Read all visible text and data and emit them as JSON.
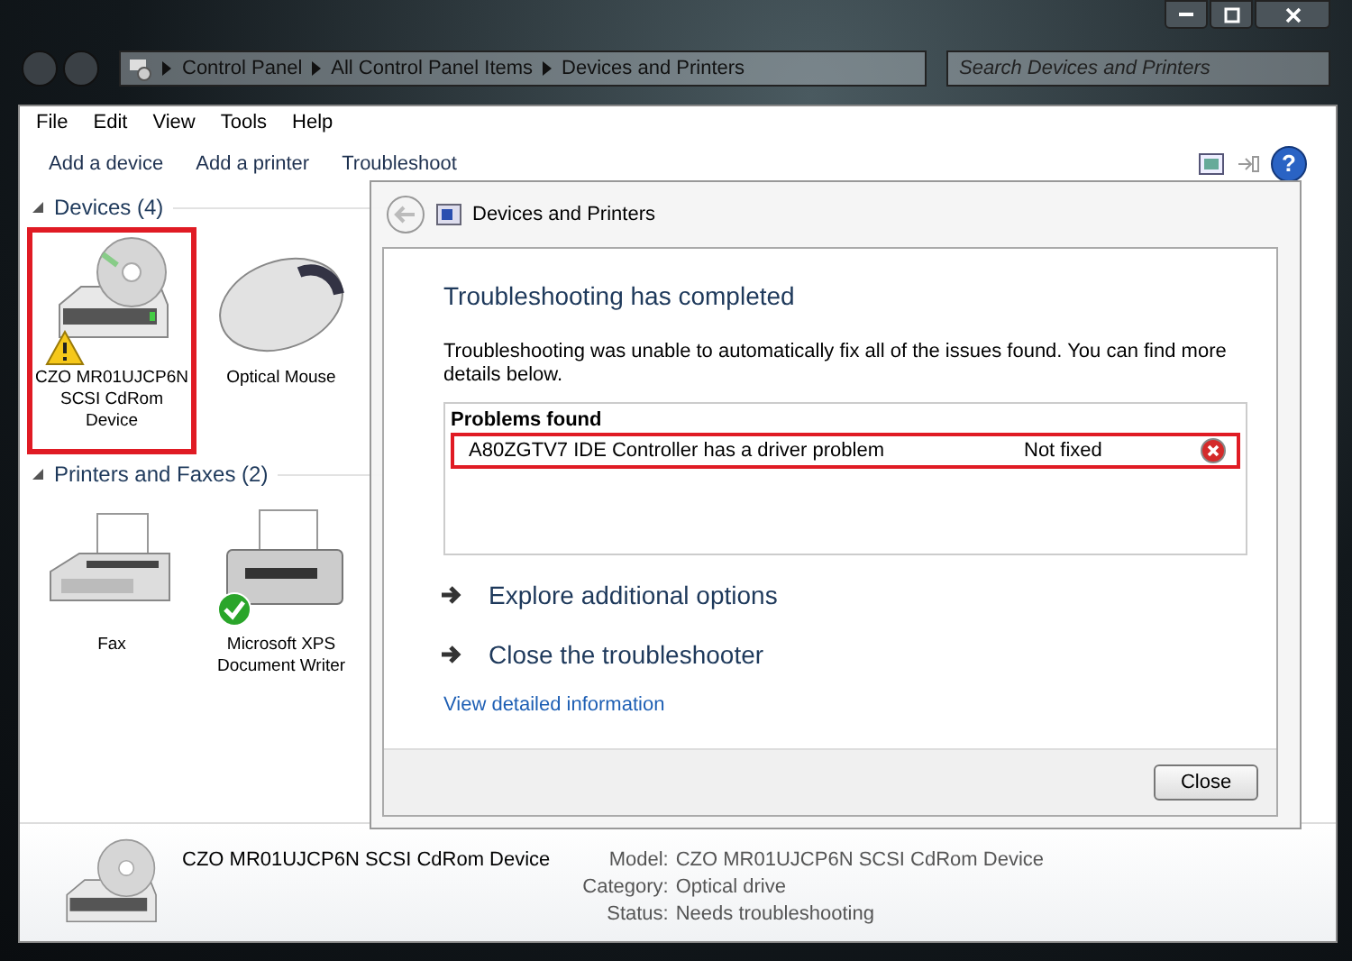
{
  "window": {
    "breadcrumb": [
      "Control Panel",
      "All Control Panel Items",
      "Devices and Printers"
    ],
    "search": {
      "placeholder": "Search Devices and Printers"
    }
  },
  "menu": [
    "File",
    "Edit",
    "View",
    "Tools",
    "Help"
  ],
  "toolbar": [
    "Add a device",
    "Add a printer",
    "Troubleshoot"
  ],
  "help": "?",
  "groups": [
    {
      "title": "Devices (4)",
      "expanded": true,
      "items": [
        {
          "label": "CZO MR01UJCP6N SCSI CdRom Device",
          "kind": "cdrom",
          "selected": true,
          "warning": true,
          "default": false
        },
        {
          "label": "Optical Mouse",
          "kind": "mouse",
          "selected": false,
          "warning": false,
          "default": false
        }
      ]
    },
    {
      "title": "Printers and Faxes (2)",
      "expanded": true,
      "items": [
        {
          "label": "Fax",
          "kind": "fax",
          "selected": false,
          "warning": false,
          "default": false
        },
        {
          "label": "Microsoft XPS Document Writer",
          "kind": "printer",
          "selected": false,
          "warning": false,
          "default": true
        }
      ]
    }
  ],
  "details": {
    "name": "CZO MR01UJCP6N SCSI CdRom Device",
    "fields": [
      {
        "label": "Model:",
        "value": "CZO MR01UJCP6N SCSI CdRom Device"
      },
      {
        "label": "Category:",
        "value": "Optical drive"
      },
      {
        "label": "Status:",
        "value": "Needs troubleshooting"
      }
    ]
  },
  "dialog": {
    "title": "Devices and Printers",
    "heading": "Troubleshooting has completed",
    "message": "Troubleshooting was unable to automatically fix all of the issues found. You can find more details below.",
    "problems_title": "Problems found",
    "problems": [
      {
        "text": "A80ZGTV7 IDE Controller has a driver problem",
        "status": "Not fixed",
        "fixed": false,
        "selected": true
      }
    ],
    "options": [
      "Explore additional options",
      "Close the troubleshooter"
    ],
    "link": "View detailed information",
    "button": "Close"
  }
}
